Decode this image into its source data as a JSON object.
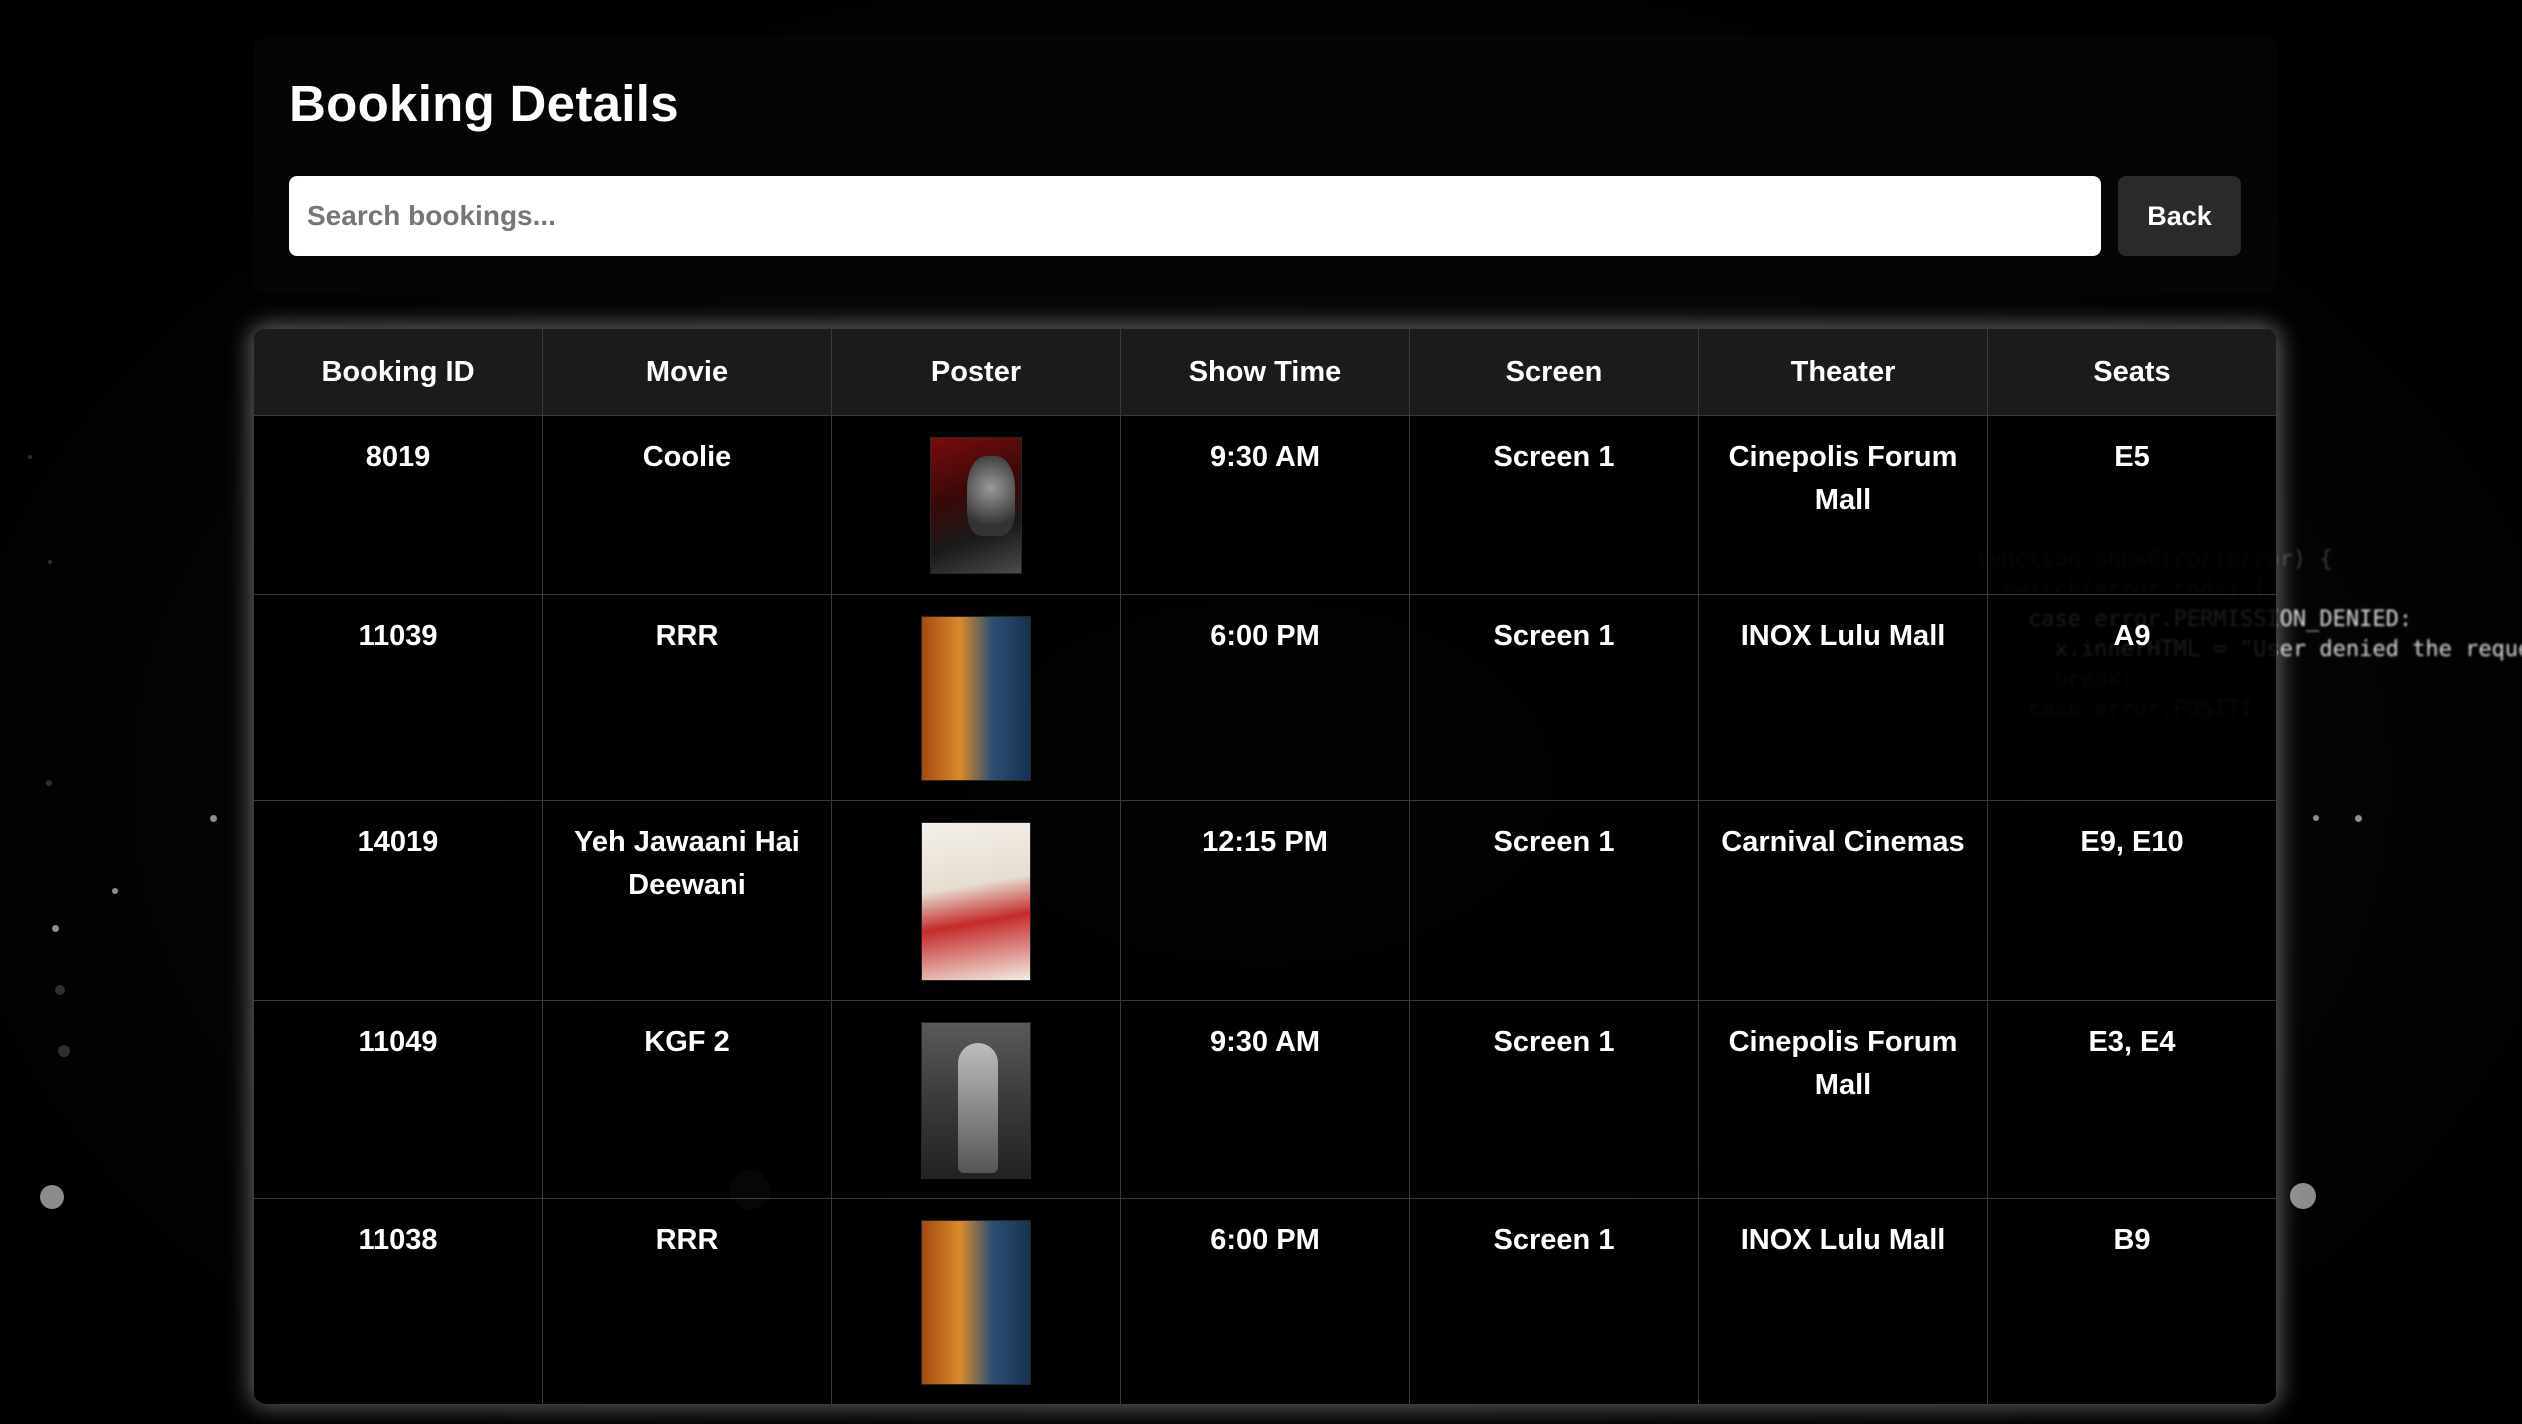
{
  "header": {
    "title": "Booking Details",
    "search_placeholder": "Search bookings...",
    "back_label": "Back"
  },
  "table": {
    "columns": [
      "Booking ID",
      "Movie",
      "Poster",
      "Show Time",
      "Screen",
      "Theater",
      "Seats"
    ],
    "rows": [
      {
        "booking_id": "8019",
        "movie": "Coolie",
        "poster": "coolie-poster",
        "show_time": "9:30 AM",
        "screen": "Screen 1",
        "theater": "Cinepolis Forum Mall",
        "seats": "E5"
      },
      {
        "booking_id": "11039",
        "movie": "RRR",
        "poster": "rrr-poster",
        "show_time": "6:00 PM",
        "screen": "Screen 1",
        "theater": "INOX Lulu Mall",
        "seats": "A9"
      },
      {
        "booking_id": "14019",
        "movie": "Yeh Jawaani Hai Deewani",
        "poster": "yjhd-poster",
        "show_time": "12:15 PM",
        "screen": "Screen 1",
        "theater": "Carnival Cinemas",
        "seats": "E9, E10"
      },
      {
        "booking_id": "11049",
        "movie": "KGF 2",
        "poster": "kgf2-poster",
        "show_time": "9:30 AM",
        "screen": "Screen 1",
        "theater": "Cinepolis Forum Mall",
        "seats": "E3, E4"
      },
      {
        "booking_id": "11038",
        "movie": "RRR",
        "poster": "rrr-poster",
        "show_time": "6:00 PM",
        "screen": "Screen 1",
        "theater": "INOX Lulu Mall",
        "seats": "B9"
      }
    ]
  },
  "background": {
    "code_lines": [
      "function showError(error) {",
      "  switch(error.code) {",
      "    case error.PERMISSION_DENIED:",
      "      x.innerHTML = \"User denied the request f",
      "      break;",
      "    case error.POSITI"
    ]
  }
}
